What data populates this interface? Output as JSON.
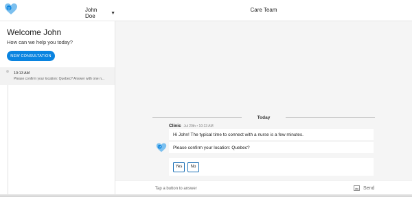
{
  "header": {
    "user_name": "John Doe",
    "title": "Care Team"
  },
  "sidebar": {
    "welcome": "Welcome John",
    "subtitle": "How can we help you today?",
    "new_button": "NEW CONSULTATION",
    "conversations": [
      {
        "time": "10:13 AM",
        "preview": "Please confirm your location: Quebec? Answer with one n..."
      }
    ]
  },
  "chat": {
    "day_label": "Today",
    "sender": "Clinic",
    "timestamp": "Jul 29th • 10:13 AM",
    "messages": [
      "Hi John! The typical time to connect with a nurse is a few minutes.",
      "Please confirm your location: Quebec?"
    ],
    "choices": [
      "Yes",
      "No"
    ]
  },
  "composer": {
    "placeholder": "Tap a button to answer",
    "send_label": "Send"
  },
  "colors": {
    "accent": "#0a84e0",
    "choice_border": "#1a6fb5"
  }
}
